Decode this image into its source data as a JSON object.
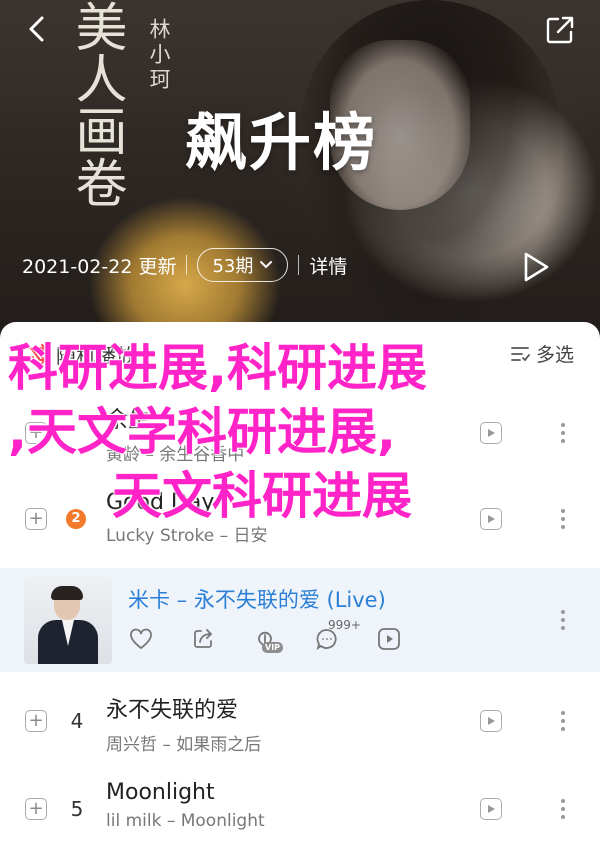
{
  "header": {
    "calligraphy": "美人画卷",
    "vertical_artist": "林小珂",
    "title": "飙升榜",
    "update_date": "2021-02-22 更新",
    "comments": "53期",
    "detail": "详情"
  },
  "list_header": {
    "play_all": "随机播放",
    "multi_select": "多选"
  },
  "songs": [
    {
      "rank": "",
      "title": "余生",
      "subtitle": "黄龄 – 余生谷香中"
    },
    {
      "rank": "2",
      "title": "Good Day",
      "subtitle": "Lucky Stroke – 日安"
    },
    {
      "rank": "",
      "title": "米卡 – 永不失联的爱 (Live)",
      "subtitle": "",
      "comment_count": "999+"
    },
    {
      "rank": "4",
      "title": "永不失联的爱",
      "subtitle": "周兴哲 – 如果雨之后"
    },
    {
      "rank": "5",
      "title": "Moonlight",
      "subtitle": "lil milk – Moonlight"
    }
  ],
  "overlay": {
    "line1": "科研进展,科研进展",
    "line2": ",天文学科研进展,",
    "line3": "天文科研进展"
  },
  "colors": {
    "overlay_text": "#ff23c8",
    "highlight_title": "#2c7fd6",
    "rank_badge": "#f27a2a"
  },
  "icons": [
    "back-arrow-icon",
    "share-icon",
    "chevron-down-icon",
    "chevron-right-icon",
    "play-icon",
    "shuffle-icon",
    "multi-select-icon",
    "add-icon",
    "mv-play-icon",
    "more-vertical-icon",
    "heart-icon",
    "forward-icon",
    "download-icon",
    "comment-icon"
  ]
}
